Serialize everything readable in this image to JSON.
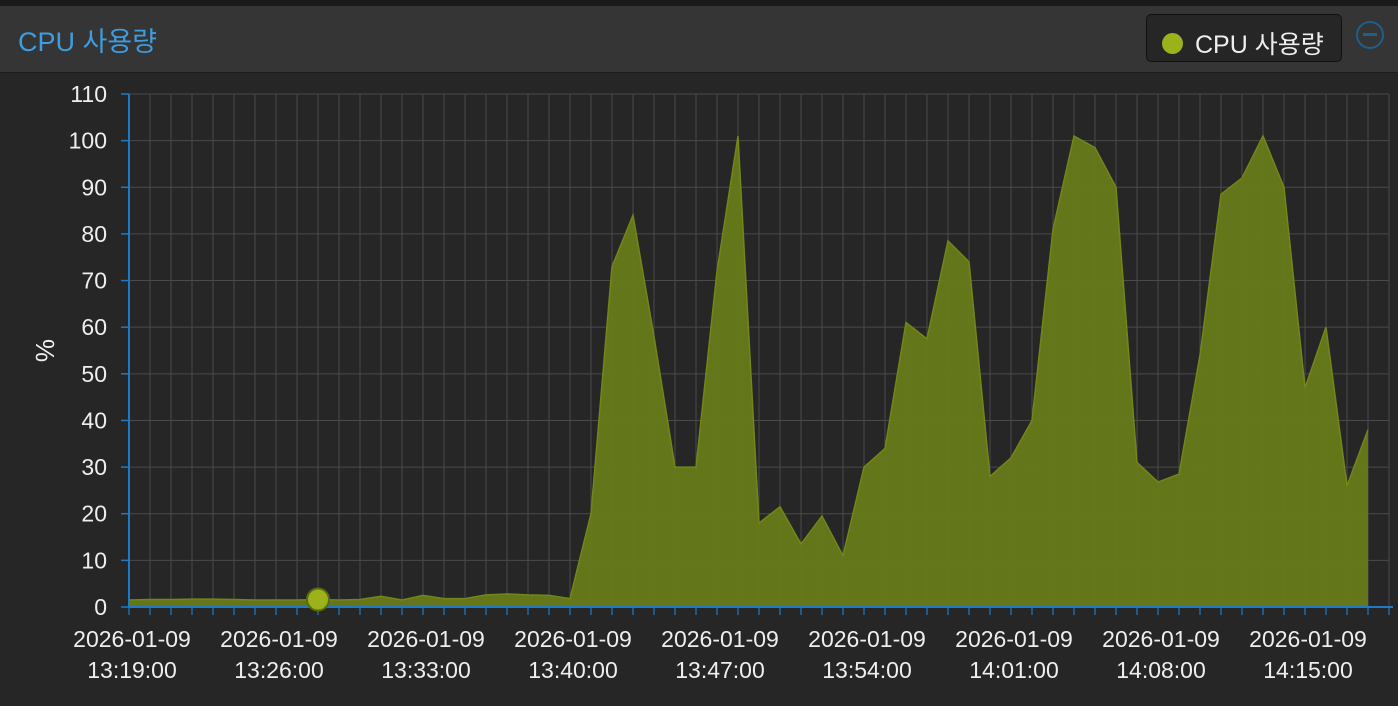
{
  "panel": {
    "title": "CPU 사용량",
    "legend_label": "CPU 사용량",
    "collapse_icon": "minus-circle-icon"
  },
  "colors": {
    "title": "#3e9ce0",
    "series": "#9bb21b",
    "area_fill": "#667a19",
    "grid": "#4a4a4a",
    "axis": "#1f79c4",
    "text": "#eeeeee"
  },
  "chart_data": {
    "type": "area",
    "title": "",
    "ylabel": "%",
    "xlabel": "",
    "ylim": [
      0,
      110
    ],
    "yticks": [
      0,
      10,
      20,
      30,
      40,
      50,
      60,
      70,
      80,
      90,
      100,
      110
    ],
    "x_start": "2026-01-09 13:19:00",
    "x_end": "2026-01-09 14:19:00",
    "x_tick_labels": [
      {
        "date": "2026-01-09",
        "time": "13:19:00"
      },
      {
        "date": "2026-01-09",
        "time": "13:26:00"
      },
      {
        "date": "2026-01-09",
        "time": "13:33:00"
      },
      {
        "date": "2026-01-09",
        "time": "13:40:00"
      },
      {
        "date": "2026-01-09",
        "time": "13:47:00"
      },
      {
        "date": "2026-01-09",
        "time": "13:54:00"
      },
      {
        "date": "2026-01-09",
        "time": "14:01:00"
      },
      {
        "date": "2026-01-09",
        "time": "14:08:00"
      },
      {
        "date": "2026-01-09",
        "time": "14:15:00"
      }
    ],
    "grid": true,
    "highlighted_point_index": 9,
    "series": [
      {
        "name": "CPU 사용량",
        "values": [
          1.5,
          1.6,
          1.6,
          1.7,
          1.7,
          1.6,
          1.5,
          1.5,
          1.5,
          1.6,
          1.5,
          1.6,
          2.3,
          1.5,
          2.5,
          1.8,
          1.8,
          2.6,
          2.8,
          2.6,
          2.5,
          1.8,
          20,
          73,
          84,
          58,
          30,
          30,
          72,
          101,
          18,
          21.5,
          13.5,
          19.5,
          11,
          30,
          34,
          61,
          57.5,
          78.5,
          74,
          28,
          32,
          40,
          81,
          101,
          98.5,
          90,
          31,
          26.8,
          28.5,
          54,
          88.5,
          92,
          101,
          90,
          47,
          60,
          26,
          38
        ]
      }
    ]
  }
}
